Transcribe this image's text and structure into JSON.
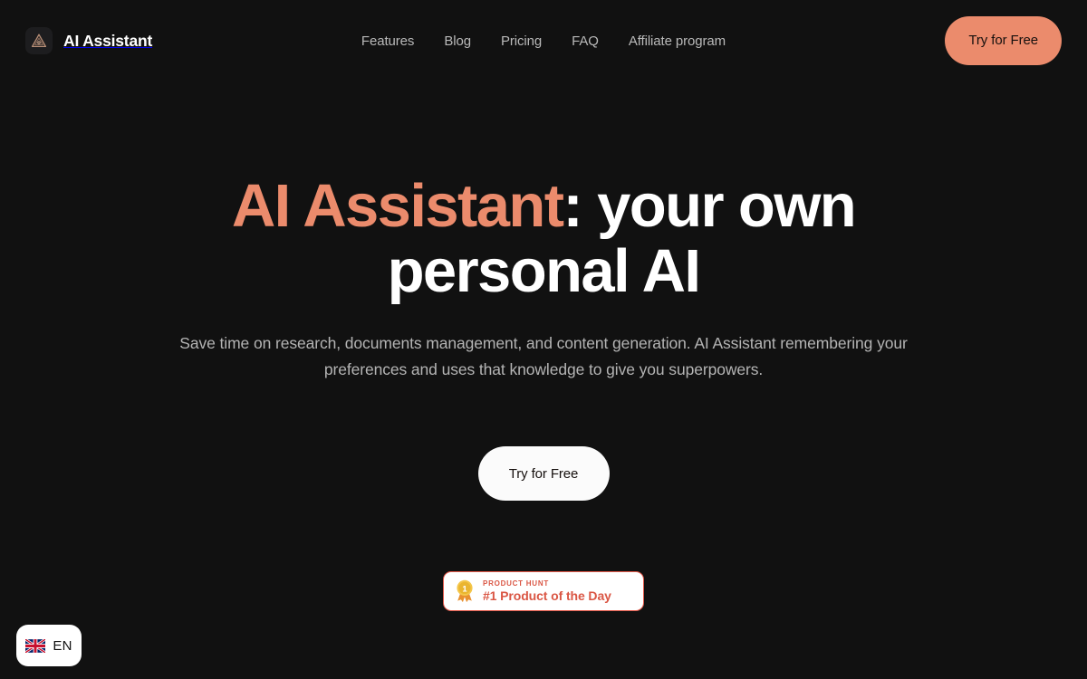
{
  "site": {
    "brand_name": "AI Assistant",
    "logo_icon": "pyramid-eye-icon"
  },
  "header": {
    "nav": [
      {
        "label": "Features"
      },
      {
        "label": "Blog"
      },
      {
        "label": "Pricing"
      },
      {
        "label": "FAQ"
      },
      {
        "label": "Affiliate program"
      }
    ],
    "cta_label": "Try for Free"
  },
  "hero": {
    "headline_accent": "AI Assistant",
    "headline_rest": ": your own personal AI",
    "subtitle": "Save time on research, documents management, and content generation. AI Assistant remembering your preferences and uses that knowledge to give you superpowers.",
    "cta_label": "Try for Free"
  },
  "product_hunt": {
    "kicker": "PRODUCT HUNT",
    "title": "#1 Product of the Day",
    "medal_icon": "gold-medal-icon",
    "medal_rank": "1"
  },
  "language": {
    "code": "EN",
    "flag_icon": "uk-flag-icon"
  },
  "colors": {
    "background": "#111111",
    "accent_coral": "#eb8b6c",
    "text_primary": "#ffffff",
    "text_muted": "#b4b4b4",
    "badge_red": "#da5644",
    "badge_border": "#e4594a"
  }
}
